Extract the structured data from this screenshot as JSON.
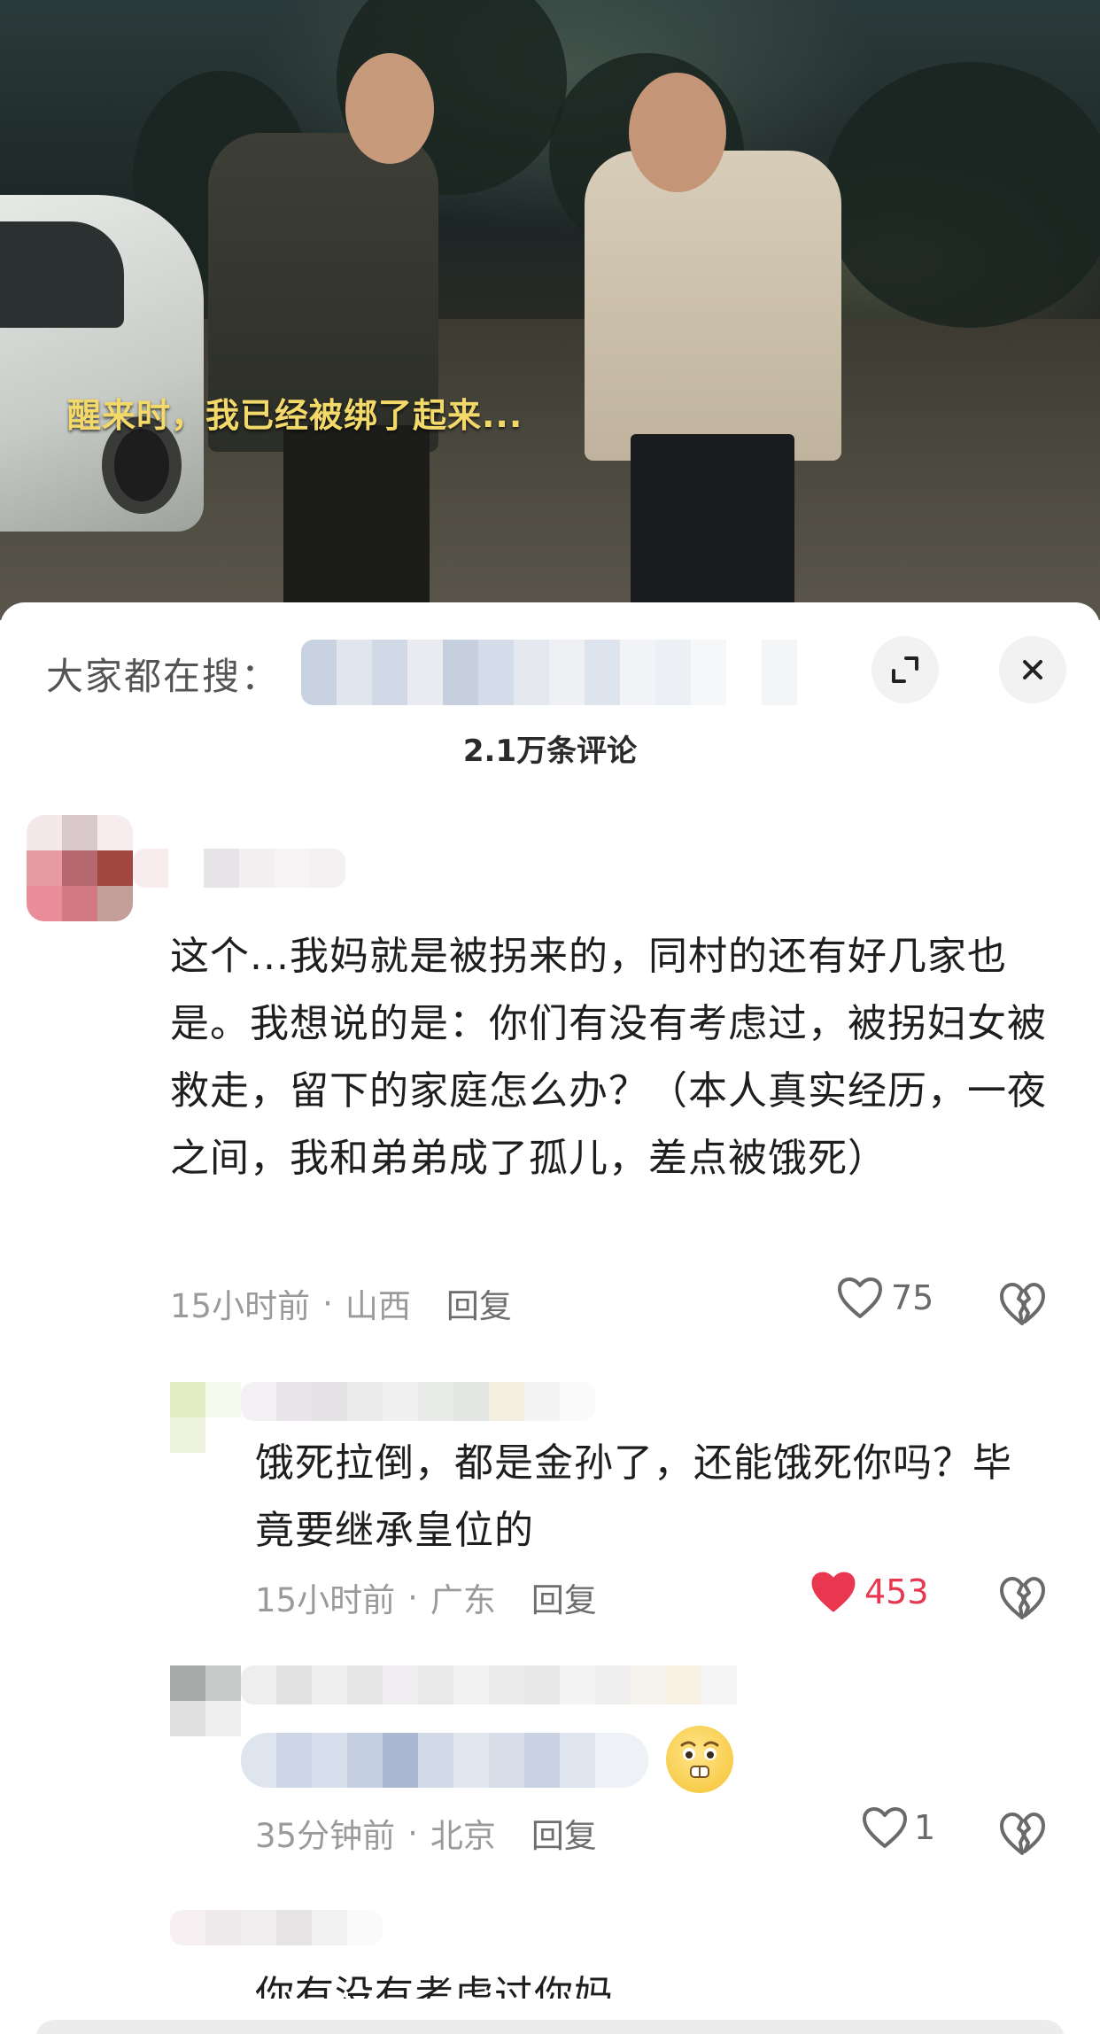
{
  "video": {
    "subtitle": "醒来时，我已经被绑了起来..."
  },
  "sheet": {
    "search_label": "大家都在搜：",
    "comment_count": "2.1万条评论",
    "icons": {
      "expand": "expand-icon",
      "close": "close-icon"
    }
  },
  "comments": [
    {
      "text": "这个...我妈就是被拐来的，同村的还有好几家也是。我想说的是：你们有没有考虑过，被拐妇女被救走，留下的家庭怎么办？（本人真实经历，一夜之间，我和弟弟成了孤儿，差点被饿死）",
      "time": "15小时前",
      "location": "山西",
      "reply": "回复",
      "likes": "75",
      "liked": false
    },
    {
      "text": "饿死拉倒，都是金孙了，还能饿死你吗？毕竟要继承皇位的",
      "time": "15小时前",
      "location": "广东",
      "reply": "回复",
      "likes": "453",
      "liked": true
    },
    {
      "text": "",
      "emoji": "grimacing-face-emoji",
      "time": "35分钟前",
      "location": "北京",
      "reply": "回复",
      "likes": "1",
      "liked": false
    },
    {
      "text": "你有没有考虑过你妈"
    }
  ],
  "colors": {
    "subtitle": "#f3d96a",
    "like_active": "#e8374f",
    "meta": "#9a9a9a"
  }
}
